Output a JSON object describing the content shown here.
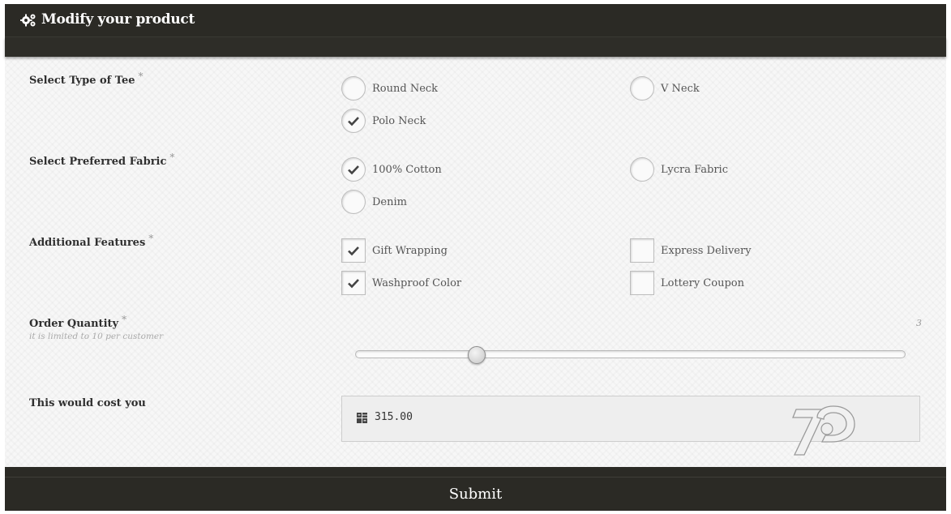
{
  "header": {
    "title": "Modify your product",
    "icon": "gears-icon"
  },
  "questions": {
    "tee_type": {
      "label": "Select Type of Tee",
      "required_mark": "*",
      "options": [
        {
          "label": "Round Neck",
          "checked": false
        },
        {
          "label": "V Neck",
          "checked": false
        },
        {
          "label": "Polo Neck",
          "checked": true
        }
      ]
    },
    "fabric": {
      "label": "Select Preferred Fabric",
      "required_mark": "*",
      "options": [
        {
          "label": "100% Cotton",
          "checked": true
        },
        {
          "label": "Lycra Fabric",
          "checked": false
        },
        {
          "label": "Denim",
          "checked": false
        }
      ]
    },
    "features": {
      "label": "Additional Features",
      "required_mark": "*",
      "options": [
        {
          "label": "Gift Wrapping",
          "checked": true
        },
        {
          "label": "Express Delivery",
          "checked": false
        },
        {
          "label": "Washproof Color",
          "checked": true
        },
        {
          "label": "Lottery Coupon",
          "checked": false
        }
      ]
    },
    "quantity": {
      "label": "Order Quantity",
      "required_mark": "*",
      "sublabel": "it is limited to 10 per customer",
      "value": "3",
      "slider_fraction": 0.22
    },
    "cost": {
      "label": "This would cost you",
      "value": "315.00",
      "icon": "calculator-icon"
    }
  },
  "footer": {
    "submit_label": "Submit"
  },
  "colors": {
    "header_bg": "#2b2a25",
    "background": "#f7f7f7",
    "check": "#444444"
  }
}
